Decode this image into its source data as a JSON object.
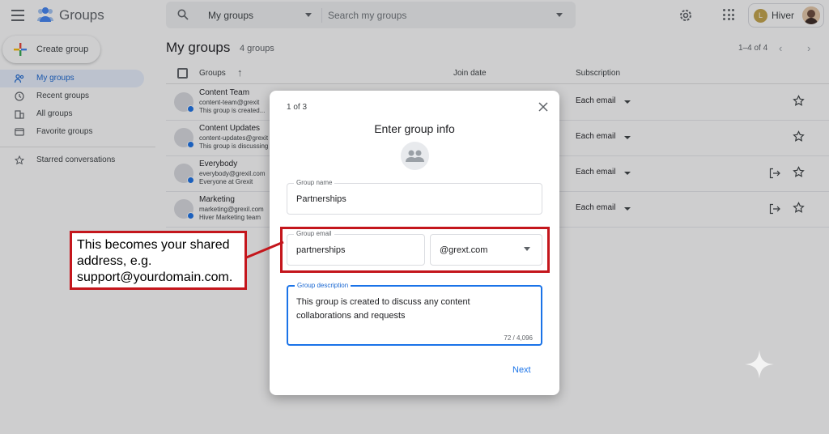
{
  "header": {
    "app_title": "Groups",
    "search_scope": "My groups",
    "search_placeholder": "Search my groups",
    "account_initial": "L",
    "account_name": "Hiver"
  },
  "sidebar": {
    "create_label": "Create group",
    "items": [
      {
        "label": "My groups",
        "icon": "people-icon",
        "active": true
      },
      {
        "label": "Recent groups",
        "icon": "clock-icon"
      },
      {
        "label": "All groups",
        "icon": "building-icon"
      },
      {
        "label": "Favorite groups",
        "icon": "folder-icon"
      },
      {
        "label": "Starred conversations",
        "icon": "star-icon"
      }
    ]
  },
  "main": {
    "title": "My groups",
    "count": "4 groups",
    "pager": "1–4 of 4",
    "columns": {
      "groups": "Groups",
      "join_date": "Join date",
      "subscription": "Subscription"
    },
    "rows": [
      {
        "name": "Content Team",
        "email": "content-team@grexit",
        "desc": "This group is created...",
        "subscription": "Each email"
      },
      {
        "name": "Content Updates",
        "email": "content-updates@grexit",
        "desc": "This group is discussing",
        "subscription": "Each email"
      },
      {
        "name": "Everybody",
        "email": "everybody@grexil.com",
        "desc": "Everyone at Grexit",
        "subscription": "Each email"
      },
      {
        "name": "Marketing",
        "email": "marketing@grexil.com",
        "desc": "Hiver Marketing team",
        "subscription": "Each email"
      }
    ]
  },
  "dialog": {
    "step": "1 of 3",
    "title": "Enter group info",
    "group_name_label": "Group name",
    "group_name_value": "Partnerships",
    "group_email_label": "Group email",
    "group_email_value": "partnerships",
    "domain_value": "@grext.com",
    "description_label": "Group description",
    "description_value": "This group is created to discuss any content collaborations and requests",
    "char_count": "72 / 4,096",
    "next_label": "Next"
  },
  "annotation": {
    "callout_text": "This becomes your shared address, e.g. support@yourdomain.com.",
    "color": "#c4161c"
  },
  "colors": {
    "accent": "#1a73e8",
    "active_nav_bg": "#e8f0fe"
  }
}
